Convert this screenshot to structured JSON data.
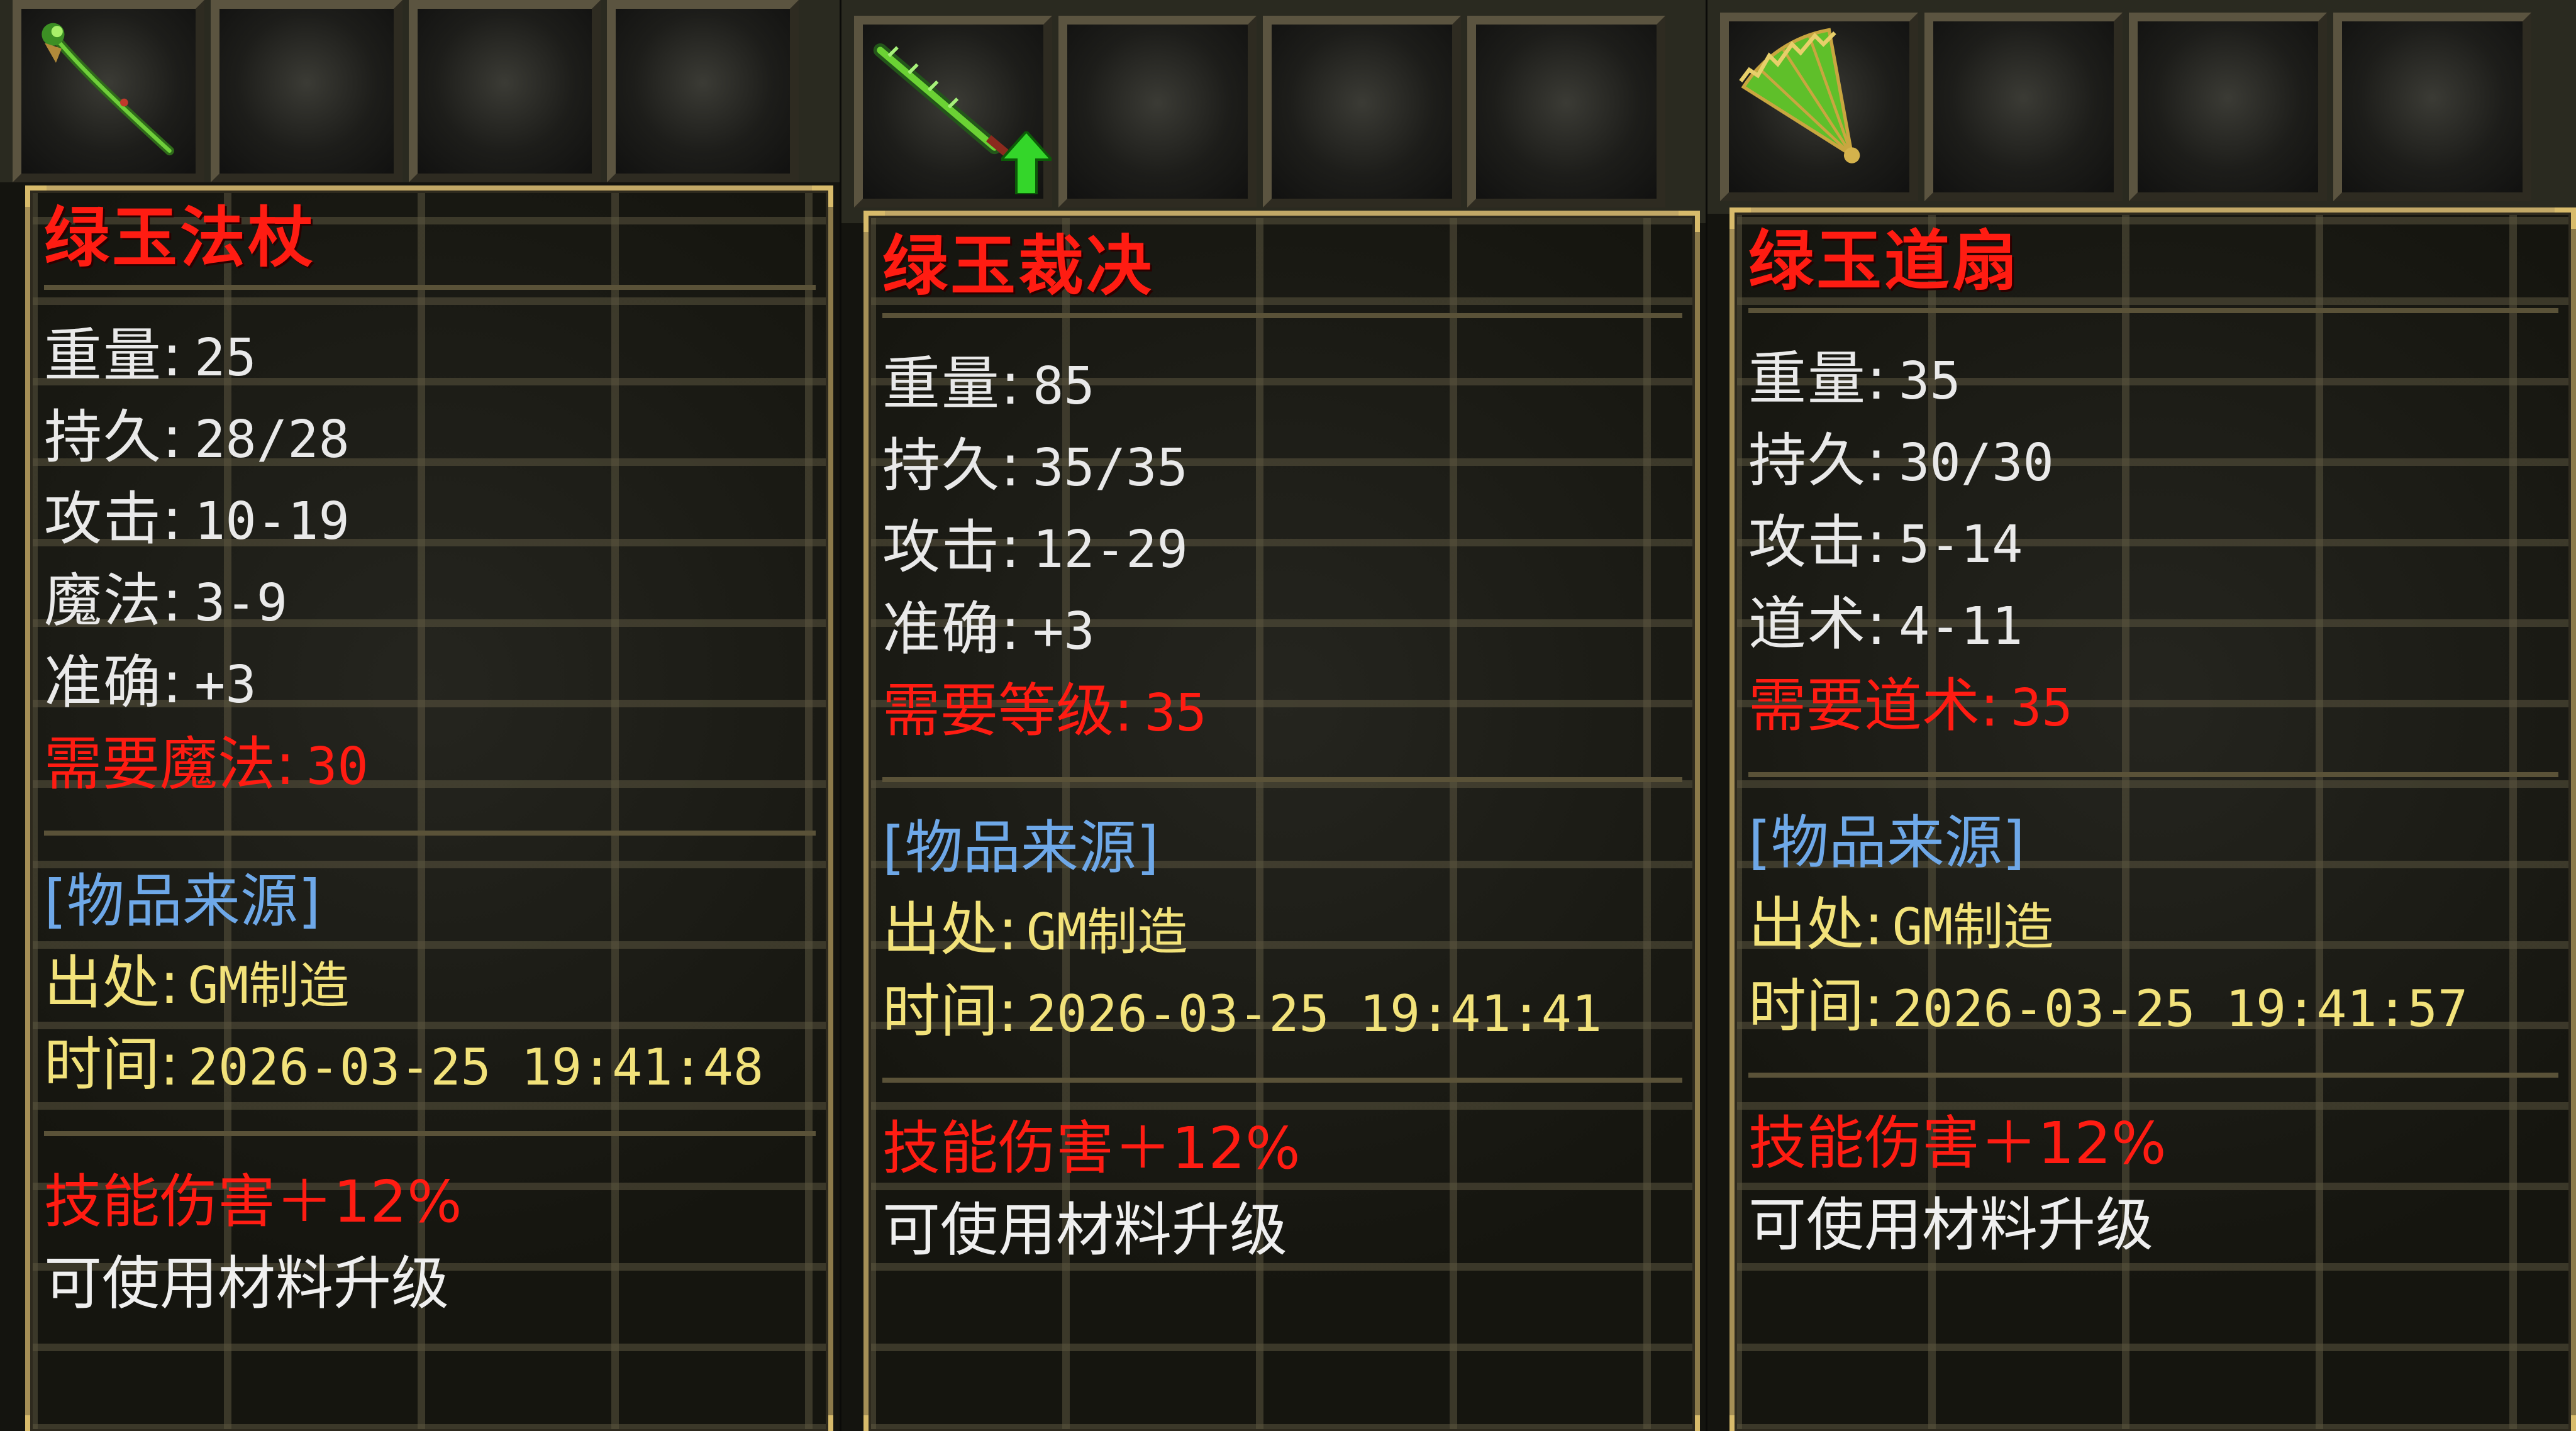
{
  "panels": [
    {
      "item": {
        "name": "绿玉法杖",
        "icon": "green-jade-staff-icon",
        "has_upgrade_arrow": false
      },
      "stats": [
        {
          "label": "重量:",
          "value": "25"
        },
        {
          "label": "持久:",
          "value": "28/28"
        },
        {
          "label": "攻击:",
          "value": "10-19"
        },
        {
          "label": "魔法:",
          "value": "3-9"
        },
        {
          "label": "准确:",
          "value": "+3"
        }
      ],
      "requirement": {
        "label": "需要魔法:",
        "value": "30"
      },
      "source": {
        "heading": "[物品来源]",
        "origin_label": "出处:",
        "origin_value": "GM制造",
        "time_label": "时间:",
        "time_value": "2026-03-25 19:41:48"
      },
      "bonus": "技能伤害＋12%",
      "upgrade_note": "可使用材料升级"
    },
    {
      "item": {
        "name": "绿玉裁决",
        "icon": "green-jade-sword-icon",
        "has_upgrade_arrow": true,
        "upgrade_arrow_icon": "green-up-arrow-icon"
      },
      "stats": [
        {
          "label": "重量:",
          "value": "85"
        },
        {
          "label": "持久:",
          "value": "35/35"
        },
        {
          "label": "攻击:",
          "value": "12-29"
        },
        {
          "label": "准确:",
          "value": "+3"
        }
      ],
      "requirement": {
        "label": "需要等级:",
        "value": "35"
      },
      "source": {
        "heading": "[物品来源]",
        "origin_label": "出处:",
        "origin_value": "GM制造",
        "time_label": "时间:",
        "time_value": "2026-03-25 19:41:41"
      },
      "bonus": "技能伤害＋12%",
      "upgrade_note": "可使用材料升级"
    },
    {
      "item": {
        "name": "绿玉道扇",
        "icon": "green-jade-fan-icon",
        "has_upgrade_arrow": false
      },
      "stats": [
        {
          "label": "重量:",
          "value": "35"
        },
        {
          "label": "持久:",
          "value": "30/30"
        },
        {
          "label": "攻击:",
          "value": "5-14"
        },
        {
          "label": "道术:",
          "value": "4-11"
        }
      ],
      "requirement": {
        "label": "需要道术:",
        "value": "35"
      },
      "source": {
        "heading": "[物品来源]",
        "origin_label": "出处:",
        "origin_value": "GM制造",
        "time_label": "时间:",
        "time_value": "2026-03-25 19:41:57"
      },
      "bonus": "技能伤害＋12%",
      "upgrade_note": "可使用材料升级"
    }
  ],
  "colors": {
    "item_name": "#ff1c12",
    "stat_text": "#e9e9e9",
    "requirement": "#ff1c12",
    "source_heading": "#6ea8e8",
    "source_text": "#f2e27a",
    "bonus": "#ff1c12",
    "frame_gold": "#c2a867"
  }
}
